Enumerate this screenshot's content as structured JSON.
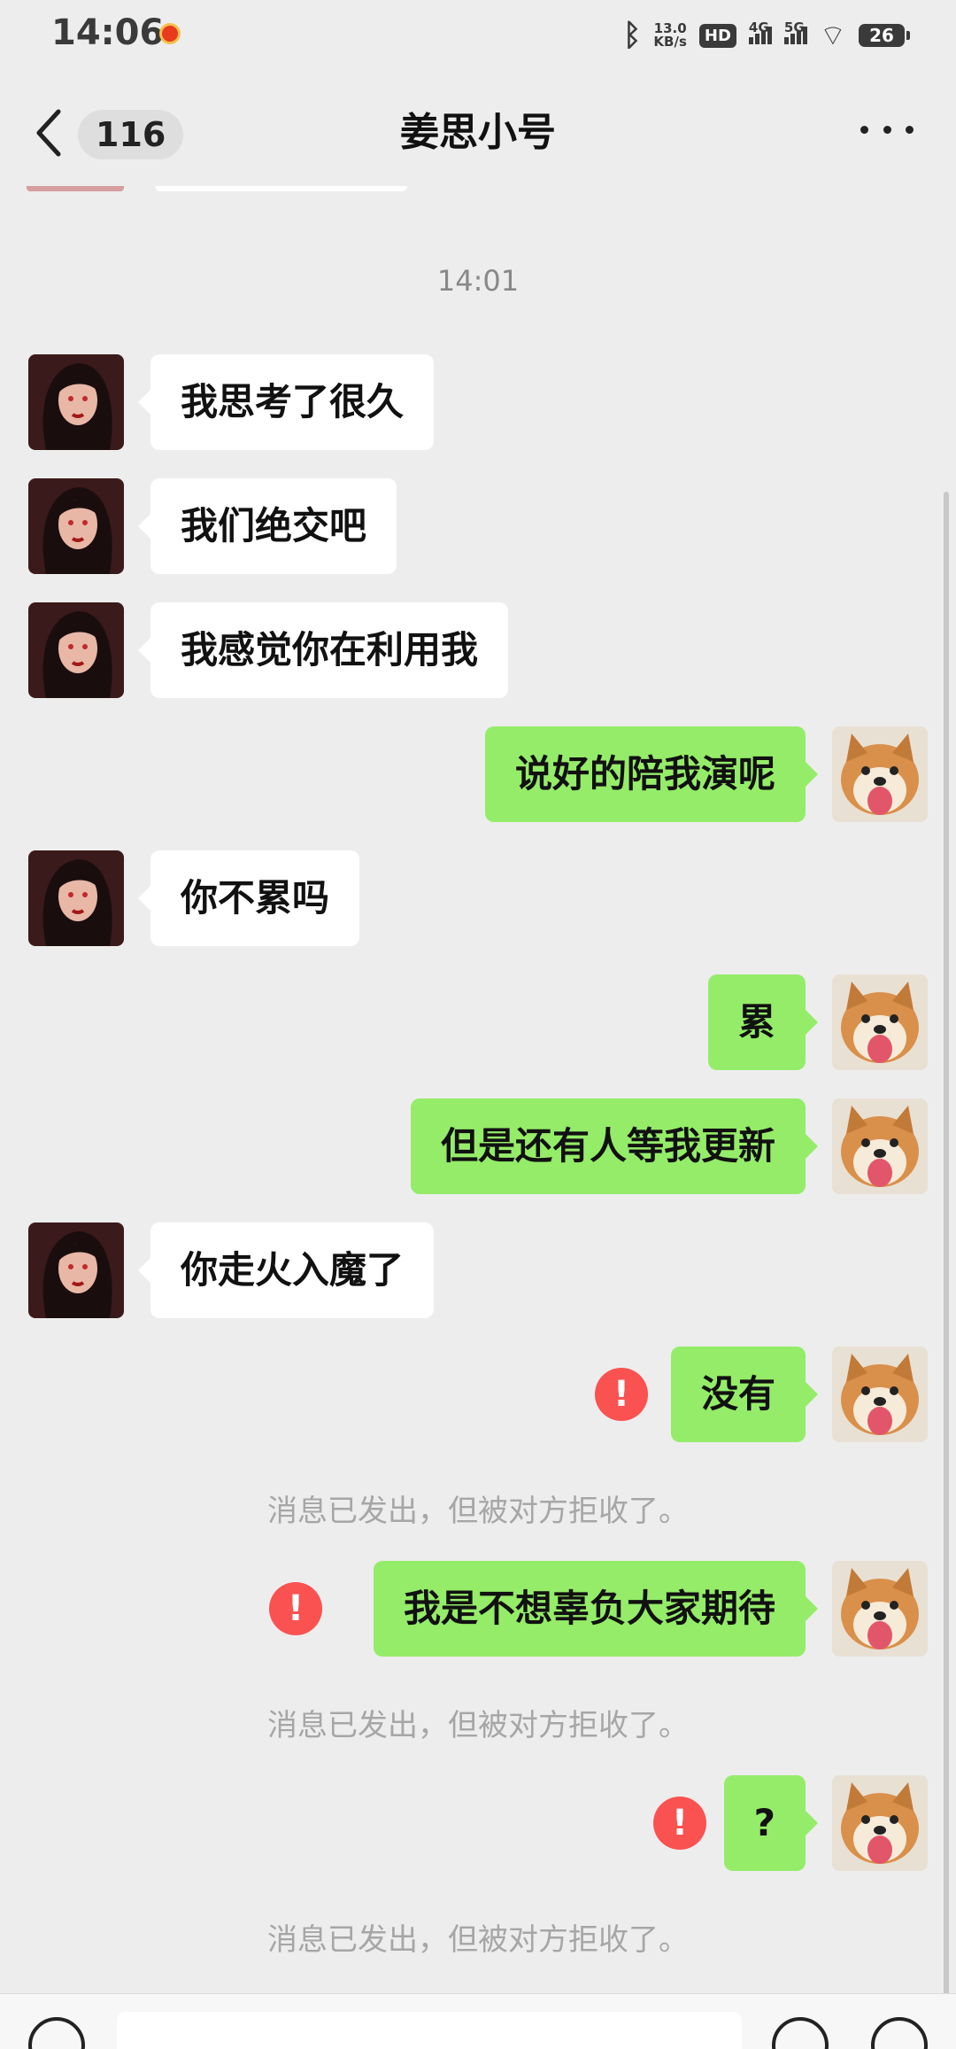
{
  "status_bar": {
    "time": "14:06",
    "net_speed_value": "13.0",
    "net_speed_unit": "KB/s",
    "hd_label": "HD",
    "signal_1_label": "4G",
    "signal_2_label": "5G",
    "battery": "26"
  },
  "nav": {
    "unread_count": "116",
    "title": "姜思小号"
  },
  "chat": {
    "timestamp": "14:01",
    "messages": [
      {
        "side": "left",
        "text": "我思考了很久"
      },
      {
        "side": "left",
        "text": "我们绝交吧"
      },
      {
        "side": "left",
        "text": "我感觉你在利用我"
      },
      {
        "side": "right",
        "text": "说好的陪我演呢"
      },
      {
        "side": "left",
        "text": "你不累吗"
      },
      {
        "side": "right",
        "text": "累"
      },
      {
        "side": "right",
        "text": "但是还有人等我更新"
      },
      {
        "side": "left",
        "text": "你走火入魔了"
      },
      {
        "side": "right",
        "text": "没有",
        "failed": true
      },
      {
        "side": "right",
        "text": "我是不想辜负大家期待",
        "failed": true
      },
      {
        "side": "right",
        "text": "?",
        "failed": true
      }
    ],
    "rejected_notice": "消息已发出，但被对方拒收了。",
    "error_mark": "!"
  },
  "icons": {
    "back": "chevron-left-icon",
    "more": "more-dots-icon",
    "error": "error-circle-icon",
    "voice": "voice-icon",
    "emoji": "emoji-icon",
    "plus": "plus-icon"
  },
  "colors": {
    "sent_bubble": "#95ec69",
    "received_bubble": "#ffffff",
    "error": "#fa5151",
    "background": "#ededed"
  }
}
